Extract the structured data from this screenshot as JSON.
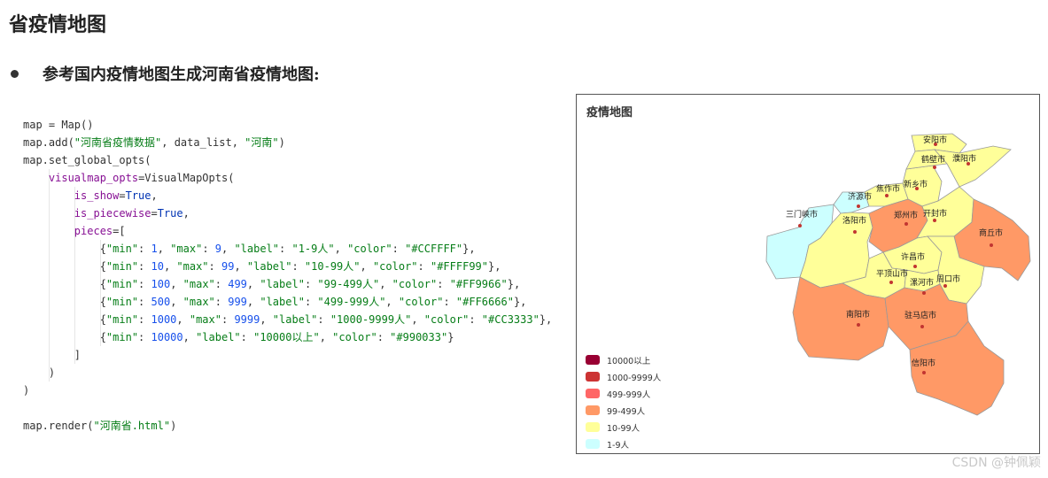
{
  "heading": "省疫情地图",
  "bullet": "参考国内疫情地图生成河南省疫情地图:",
  "code": {
    "l1": "map = Map()",
    "l2_a": "map.add(",
    "l2_s1": "\"河南省疫情数据\"",
    "l2_b": ", data_list, ",
    "l2_s2": "\"河南\"",
    "l2_c": ")",
    "l3": "map.set_global_opts(",
    "l4_p": "visualmap_opts",
    "l4_b": "=VisualMapOpts(",
    "l5_p": "is_show",
    "l5_v": "True",
    "l6_p": "is_piecewise",
    "l6_v": "True",
    "l7_p": "pieces",
    "l7_b": "=[",
    "pieces": [
      {
        "min": "1",
        "max": "9",
        "label": "\"1-9人\"",
        "color": "\"#CCFFFF\""
      },
      {
        "min": "10",
        "max": "99",
        "label": "\"10-99人\"",
        "color": "\"#FFFF99\""
      },
      {
        "min": "100",
        "max": "499",
        "label": "\"99-499人\"",
        "color": "\"#FF9966\""
      },
      {
        "min": "500",
        "max": "999",
        "label": "\"499-999人\"",
        "color": "\"#FF6666\""
      },
      {
        "min": "1000",
        "max": "9999",
        "label": "\"1000-9999人\"",
        "color": "\"#CC3333\""
      }
    ],
    "last_min": "10000",
    "last_label": "\"10000以上\"",
    "last_color": "\"#990033\"",
    "close_bracket": "]",
    "close_paren1": ")",
    "close_paren2": ")",
    "render_a": "map.render(",
    "render_s": "\"河南省.html\"",
    "render_b": ")"
  },
  "map_panel": {
    "title": "疫情地图",
    "cities": [
      "安阳市",
      "鹤壁市",
      "濮阳市",
      "新乡市",
      "焦作市",
      "济源市",
      "三门峡市",
      "洛阳市",
      "郑州市",
      "开封市",
      "商丘市",
      "许昌市",
      "平顶山市",
      "漯河市",
      "周口市",
      "南阳市",
      "驻马店市",
      "信阳市"
    ],
    "legend": [
      {
        "label": "10000以上",
        "color": "#990033"
      },
      {
        "label": "1000-9999人",
        "color": "#CC3333"
      },
      {
        "label": "499-999人",
        "color": "#FF6666"
      },
      {
        "label": "99-499人",
        "color": "#FF9966"
      },
      {
        "label": "10-99人",
        "color": "#FFFF99"
      },
      {
        "label": "1-9人",
        "color": "#CCFFFF"
      }
    ]
  },
  "watermark": "CSDN @钟佩颖"
}
